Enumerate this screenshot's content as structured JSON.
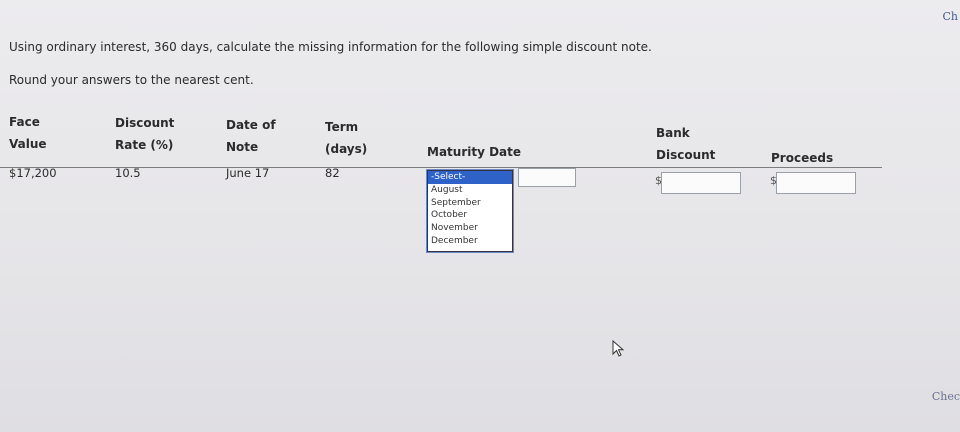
{
  "corner": {
    "top_text": "Ch",
    "bottom_text": "Chec"
  },
  "instructions": "Using ordinary interest, 360 days, calculate the missing information for the following simple discount note.",
  "round_note": "Round your answers to the nearest cent.",
  "headers": {
    "face_value": [
      "Face",
      "Value"
    ],
    "discount_rate": [
      "Discount",
      "Rate (%)"
    ],
    "date_of_note": [
      "Date of",
      "Note"
    ],
    "term": [
      "Term",
      "(days)"
    ],
    "maturity_date": "Maturity Date",
    "bank_discount": [
      "Bank",
      "Discount"
    ],
    "proceeds": "Proceeds"
  },
  "row": {
    "face_value": "$17,200",
    "discount_rate": "10.5",
    "date_of_note": "June 17",
    "term": "82"
  },
  "maturity_select": {
    "options": [
      "-Select-",
      "August",
      "September",
      "October",
      "November",
      "December"
    ],
    "selected": "-Select-"
  },
  "maturity_day_value": "",
  "bank_discount_field": {
    "currency": "$",
    "value": ""
  },
  "proceeds_field": {
    "currency": "$",
    "value": ""
  },
  "colors": {
    "select_highlight": "#2f62c9",
    "background": "#e9e8ea"
  }
}
